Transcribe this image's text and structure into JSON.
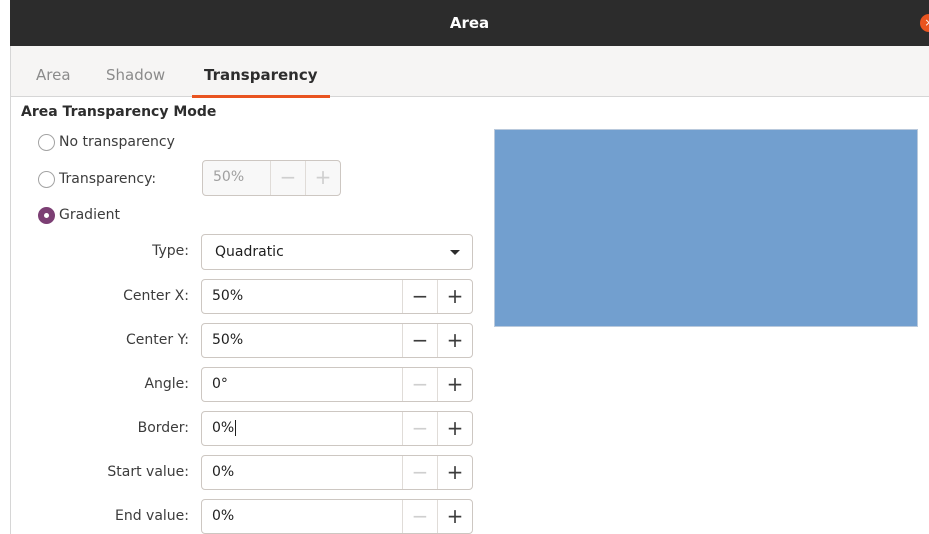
{
  "window": {
    "title": "Area",
    "close_glyph": "×"
  },
  "tabs": [
    {
      "label": "Area"
    },
    {
      "label": "Shadow"
    },
    {
      "label": "Transparency"
    }
  ],
  "section": {
    "title": "Area Transparency Mode"
  },
  "modes": {
    "no_transparency": "No transparency",
    "transparency": "Transparency:",
    "gradient": "Gradient",
    "selected": "Gradient"
  },
  "transparency_spin": {
    "value": "50%",
    "minus": "−",
    "plus": "+"
  },
  "gradient": {
    "type": {
      "label": "Type:",
      "value": "Quadratic"
    },
    "center_x": {
      "label": "Center X:",
      "value": "50%"
    },
    "center_y": {
      "label": "Center Y:",
      "value": "50%"
    },
    "angle": {
      "label": "Angle:",
      "value": "0°"
    },
    "border": {
      "label": "Border:",
      "value": "0%"
    },
    "start_value": {
      "label": "Start value:",
      "value": "0%"
    },
    "end_value": {
      "label": "End value:",
      "value": "0%"
    },
    "minus": "−",
    "plus": "+"
  },
  "colors": {
    "accent": "#e95420",
    "radio_checked": "#7c3f74",
    "preview_fill": "#729fcf"
  }
}
